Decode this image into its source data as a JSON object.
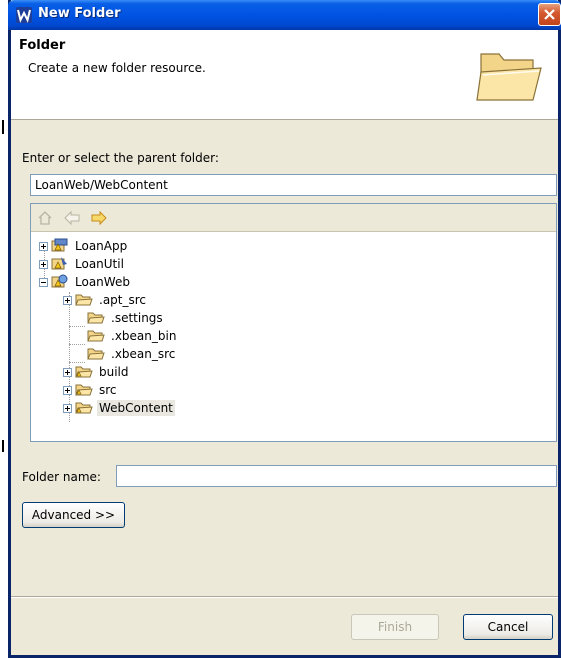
{
  "window": {
    "title": "New Folder",
    "close_tooltip": "Close"
  },
  "header": {
    "title": "Folder",
    "description": "Create a new folder resource."
  },
  "parent": {
    "label": "Enter or select the parent folder:",
    "value": "LoanWeb/WebContent"
  },
  "tree": {
    "toolbar": [
      "home-icon",
      "back-arrow-icon",
      "forward-arrow-icon"
    ],
    "items": [
      {
        "label": "LoanApp",
        "expander": "+",
        "icon": "project-icon"
      },
      {
        "label": "LoanUtil",
        "expander": "+",
        "icon": "java-project-icon"
      },
      {
        "label": "LoanWeb",
        "expander": "-",
        "icon": "web-project-icon"
      },
      {
        "label": ".apt_src",
        "expander": "+",
        "icon": "folder-icon"
      },
      {
        "label": ".settings",
        "expander": "",
        "icon": "folder-icon"
      },
      {
        "label": ".xbean_bin",
        "expander": "",
        "icon": "folder-icon"
      },
      {
        "label": ".xbean_src",
        "expander": "",
        "icon": "folder-icon"
      },
      {
        "label": "build",
        "expander": "+",
        "icon": "folder-icon"
      },
      {
        "label": "src",
        "expander": "+",
        "icon": "folder-icon"
      },
      {
        "label": "WebContent",
        "expander": "+",
        "icon": "folder-icon",
        "selected": true
      }
    ]
  },
  "folder_name": {
    "label": "Folder name:",
    "value": ""
  },
  "buttons": {
    "advanced": "Advanced >>",
    "finish": "Finish",
    "cancel": "Cancel"
  }
}
